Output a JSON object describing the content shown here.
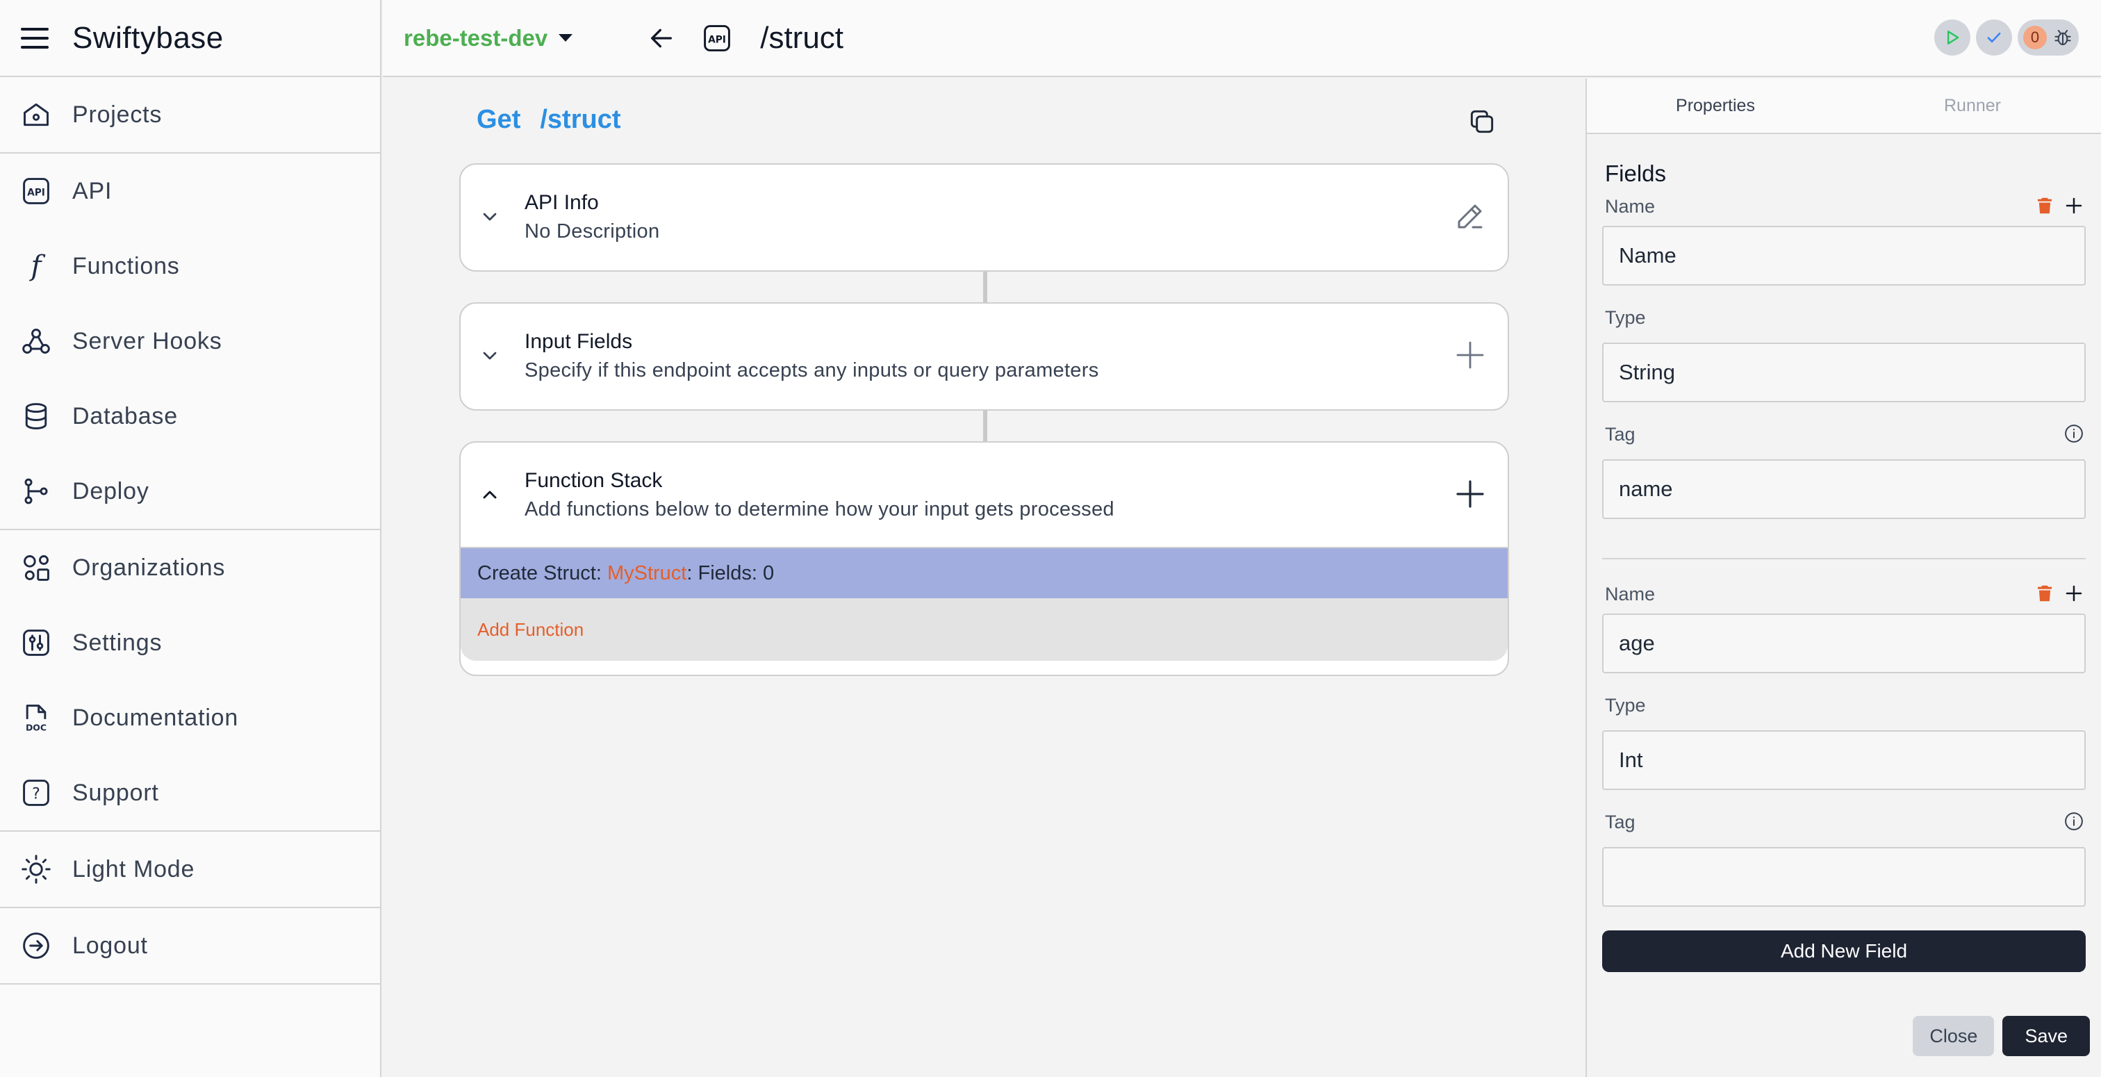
{
  "app": {
    "title": "Swiftybase"
  },
  "sidebar": {
    "items": [
      {
        "label": "Projects",
        "icon": "home-icon"
      },
      {
        "label": "API",
        "icon": "api-icon"
      },
      {
        "label": "Functions",
        "icon": "function-icon"
      },
      {
        "label": "Server Hooks",
        "icon": "webhook-icon"
      },
      {
        "label": "Database",
        "icon": "database-icon"
      },
      {
        "label": "Deploy",
        "icon": "git-branch-icon"
      },
      {
        "label": "Organizations",
        "icon": "shapes-icon"
      },
      {
        "label": "Settings",
        "icon": "settings-sliders-icon"
      },
      {
        "label": "Documentation",
        "icon": "doc-file-icon"
      },
      {
        "label": "Support",
        "icon": "help-icon"
      },
      {
        "label": "Light Mode",
        "icon": "sun-icon"
      },
      {
        "label": "Logout",
        "icon": "logout-icon"
      }
    ]
  },
  "topbar": {
    "project_name": "rebe-test-dev",
    "route": "/struct",
    "issue_count": "0",
    "colors": {
      "project": "#4caf50",
      "run": "#22c55e",
      "check": "#3b82f6",
      "count_badge": "#f4a581"
    }
  },
  "endpoint": {
    "method": "Get",
    "path": "/struct",
    "color": "#2b8fe3"
  },
  "cards": {
    "api_info": {
      "title": "API Info",
      "subtitle": "No Description"
    },
    "input_fields": {
      "title": "Input Fields",
      "subtitle": "Specify if this endpoint accepts any inputs or query parameters"
    },
    "function_stack": {
      "title": "Function Stack",
      "subtitle": "Add functions below to determine how your input gets processed",
      "function": {
        "prefix": "Create Struct: ",
        "struct_name": "MyStruct",
        "suffix": ": Fields: 0"
      },
      "add_function": "Add Function"
    }
  },
  "panel": {
    "tabs": [
      "Properties",
      "Runner"
    ],
    "active_tab": "Properties",
    "section_title": "Fields",
    "labels": {
      "name": "Name",
      "type": "Type",
      "tag": "Tag"
    },
    "fields": [
      {
        "name": "Name",
        "type": "String",
        "tag": "name"
      },
      {
        "name": "age",
        "type": "Int",
        "tag": ""
      }
    ],
    "add_field": "Add New Field",
    "close": "Close",
    "save": "Save",
    "colors": {
      "delete": "#e45f2b",
      "primary_button": "#1f2433"
    }
  }
}
